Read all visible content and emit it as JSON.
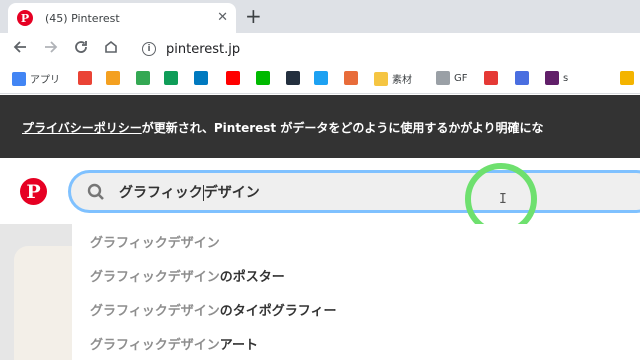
{
  "browser": {
    "tab_title": "(45) Pinterest",
    "tab_favicon": "P",
    "new_tab_label": "+",
    "close_label": "✕",
    "url": "pinterest.jp"
  },
  "bookmarks": [
    {
      "label": "アプリ",
      "icon": "apps-grid-icon",
      "color": "#4285f4"
    },
    {
      "label": "",
      "icon": "pinwheel-icon",
      "color": "#ea4335"
    },
    {
      "label": "",
      "icon": "v-icon",
      "color": "#f4a020"
    },
    {
      "label": "",
      "icon": "drive-icon",
      "color": "#34a853"
    },
    {
      "label": "",
      "icon": "sheets-plus-icon",
      "color": "#0f9d58"
    },
    {
      "label": "",
      "icon": "trello-icon",
      "color": "#0079bf"
    },
    {
      "label": "",
      "icon": "youtube-icon",
      "color": "#ff0000"
    },
    {
      "label": "",
      "icon": "line-icon",
      "color": "#00b900"
    },
    {
      "label": "",
      "icon": "amazon-icon",
      "color": "#232f3e"
    },
    {
      "label": "",
      "icon": "twitter-icon",
      "color": "#1da1f2"
    },
    {
      "label": "",
      "icon": "figure-icon",
      "color": "#e86c3a"
    },
    {
      "label": "素材",
      "icon": "folder-icon",
      "color": "#f5c542"
    },
    {
      "label": "GF",
      "icon": "gf-icon",
      "color": "#9aa0a6"
    },
    {
      "label": "",
      "icon": "gift-icon",
      "color": "#e53935"
    },
    {
      "label": "",
      "icon": "blocks-icon",
      "color": "#4a6ee0"
    },
    {
      "label": "s",
      "icon": "slack-icon",
      "color": "#611f69"
    },
    {
      "label": "",
      "icon": "chick-icon",
      "color": "#f4b400"
    }
  ],
  "banner": {
    "link_text": "プライバシーポリシー",
    "text": "が更新され、Pinterest がデータをどのように使用するかがより明確にな"
  },
  "search": {
    "value_before_caret": "グラフィック",
    "value_after_caret": "デザイン"
  },
  "suggestions": [
    {
      "base": "グラフィックデザイン",
      "extra": ""
    },
    {
      "base": "グラフィックデザイン",
      "extra": "のポスター"
    },
    {
      "base": "グラフィックデザイン",
      "extra": "のタイポグラフィー"
    },
    {
      "base": "グラフィックデザイン",
      "extra": "アート"
    }
  ]
}
